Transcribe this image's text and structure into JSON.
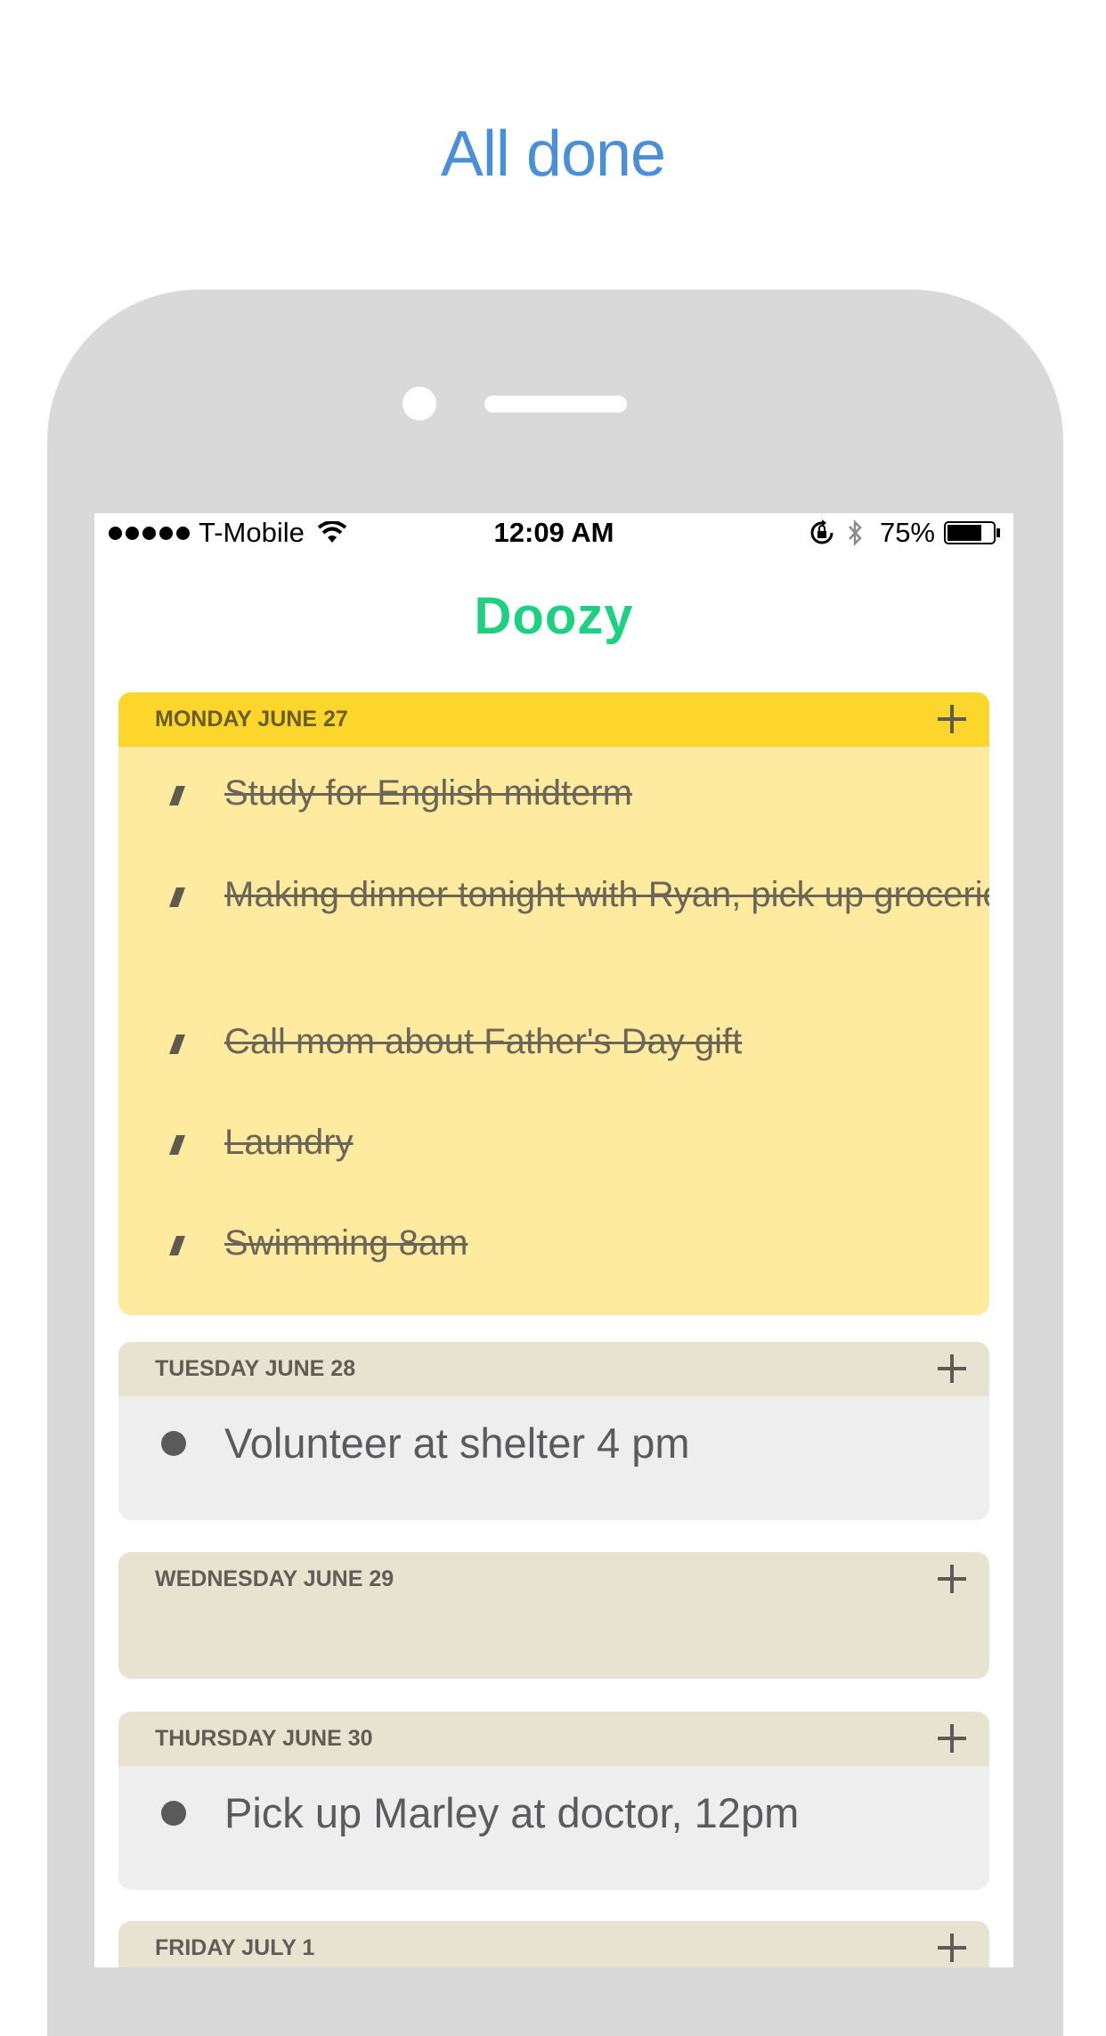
{
  "headline": "All done",
  "status_bar": {
    "carrier": "T-Mobile",
    "time": "12:09 AM",
    "battery": "75%"
  },
  "app": {
    "title": "Doozy"
  },
  "days": [
    {
      "label": "MONDAY JUNE 27",
      "items": [
        "Study for English midterm",
        "Making dinner tonight with Ryan, pick up groceries",
        "Call mom about Father's Day gift",
        "Laundry",
        "Swimming 8am"
      ]
    },
    {
      "label": "TUESDAY JUNE 28",
      "items": [
        "Volunteer at shelter 4 pm"
      ]
    },
    {
      "label": "WEDNESDAY JUNE 29",
      "items": []
    },
    {
      "label": "THURSDAY JUNE 30",
      "items": [
        "Pick up Marley at doctor, 12pm"
      ]
    },
    {
      "label": "FRIDAY JULY 1",
      "items": []
    }
  ],
  "colors": {
    "headline": "#4a90d9",
    "brand": "#1ed182",
    "active_header": "#fdd62b",
    "active_body": "#feeba0",
    "day_header": "#e8e2d1",
    "day_body": "#eeeeee"
  },
  "icons": {
    "add": "plus-icon",
    "done": "check-slash-icon",
    "pending": "bullet-icon"
  }
}
